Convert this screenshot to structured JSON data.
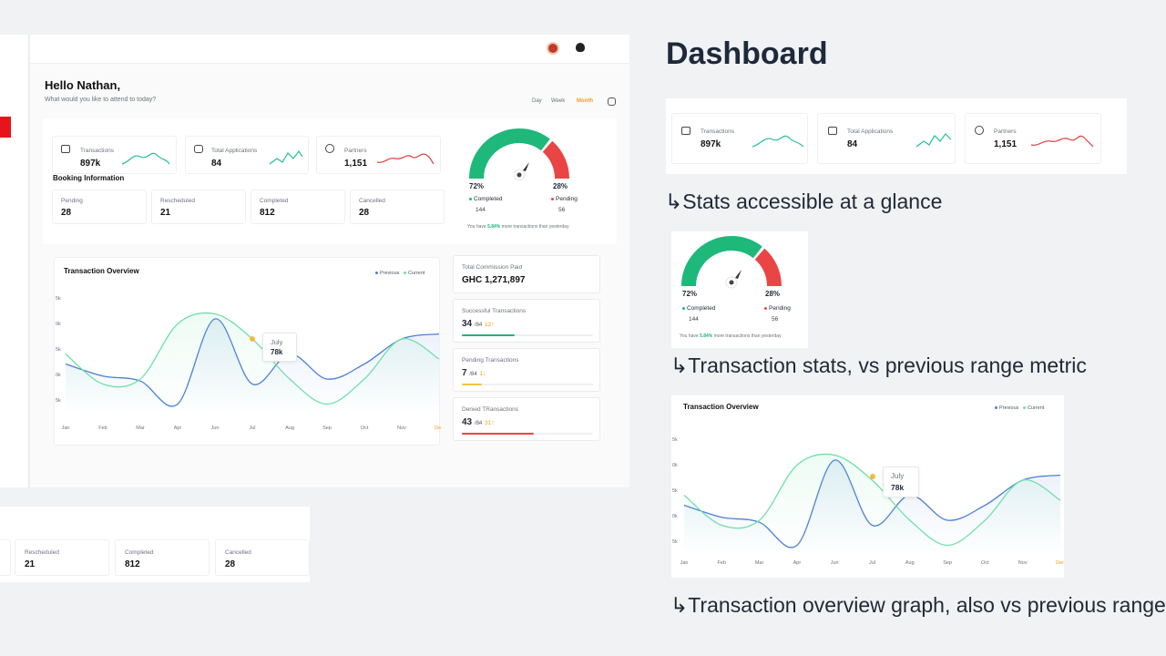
{
  "header": {
    "title": "Hello Nathan,",
    "subtitle": "What would you like to attend to today?"
  },
  "range_tabs": [
    "Day",
    "Week",
    "Month"
  ],
  "active_tab": "Month",
  "stats": [
    {
      "label": "Transactions",
      "value": "897k",
      "icon": "card-icon",
      "trend_color": "#22c08e"
    },
    {
      "label": "Total Applications",
      "value": "84",
      "icon": "plus-box-icon",
      "trend_color": "#22c08e"
    },
    {
      "label": "Partners",
      "value": "1,151",
      "icon": "user-circle-icon",
      "trend_color": "#e23a3a"
    }
  ],
  "booking": {
    "title": "Booking Information",
    "items": [
      {
        "label": "Pending",
        "value": "28"
      },
      {
        "label": "Rescheduled",
        "value": "21"
      },
      {
        "label": "Completed",
        "value": "812"
      },
      {
        "label": "Cancelled",
        "value": "28"
      }
    ]
  },
  "gauge": {
    "completed_pct": "72%",
    "pending_pct": "28%",
    "completed_label": "Completed",
    "pending_label": "Pending",
    "completed_count": "144",
    "pending_count": "56",
    "note_pre": "You have ",
    "note_value": "5.84%",
    "note_post": " more transactions than yesterday",
    "colors": {
      "completed": "#1db87a",
      "pending": "#ea4545"
    },
    "completed_fraction": 0.72
  },
  "overview": {
    "title": "Transaction Overview",
    "legend": [
      "Previous",
      "Current"
    ],
    "tooltip_month": "July",
    "tooltip_value": "78k",
    "y_ticks": [
      "5k",
      "0k",
      "5k",
      "0k",
      "5k"
    ],
    "zoom_y_ticks": [
      "5k",
      "0k",
      "5k",
      "0k",
      "5k"
    ]
  },
  "chart_data": {
    "type": "line",
    "x": [
      "Jan",
      "Feb",
      "Mar",
      "Apr",
      "Jun",
      "Jul",
      "Aug",
      "Sep",
      "Oct",
      "Nov",
      "Dec"
    ],
    "series": [
      {
        "name": "Previous",
        "color": "#4a7fd6",
        "values": [
          0.45,
          0.33,
          0.28,
          0.05,
          0.9,
          0.25,
          0.55,
          0.3,
          0.45,
          0.7,
          0.75
        ]
      },
      {
        "name": "Current",
        "color": "#6ee0a8",
        "values": [
          0.55,
          0.25,
          0.3,
          0.85,
          0.95,
          0.7,
          0.3,
          0.05,
          0.3,
          0.7,
          0.5
        ]
      }
    ],
    "highlighted_x": "Dec",
    "grid": false,
    "legend_position": "top-right"
  },
  "side": {
    "commission_label": "Total Commission Paid",
    "commission_value": "GHC 1,271,897",
    "items": [
      {
        "label": "Successful Transactions",
        "value": "34",
        "total": "/84",
        "delta": "12",
        "dir": "up",
        "color": "#1db87a",
        "fraction": 0.4
      },
      {
        "label": "Pending Transactions",
        "value": "7",
        "total": "/84",
        "delta": "1",
        "dir": "down",
        "color": "#f5c542",
        "fraction": 0.15
      },
      {
        "label": "Denied TRansactions",
        "value": "43",
        "total": "/84",
        "delta": "31",
        "dir": "up",
        "color": "#ea4545",
        "fraction": 0.55
      }
    ]
  },
  "annotations": {
    "title": "Dashboard",
    "cap1": "↳Stats accessible at a glance",
    "cap2": "↳Transaction stats, vs previous range metric",
    "cap3": "↳Transaction overview graph, also vs previous range"
  }
}
